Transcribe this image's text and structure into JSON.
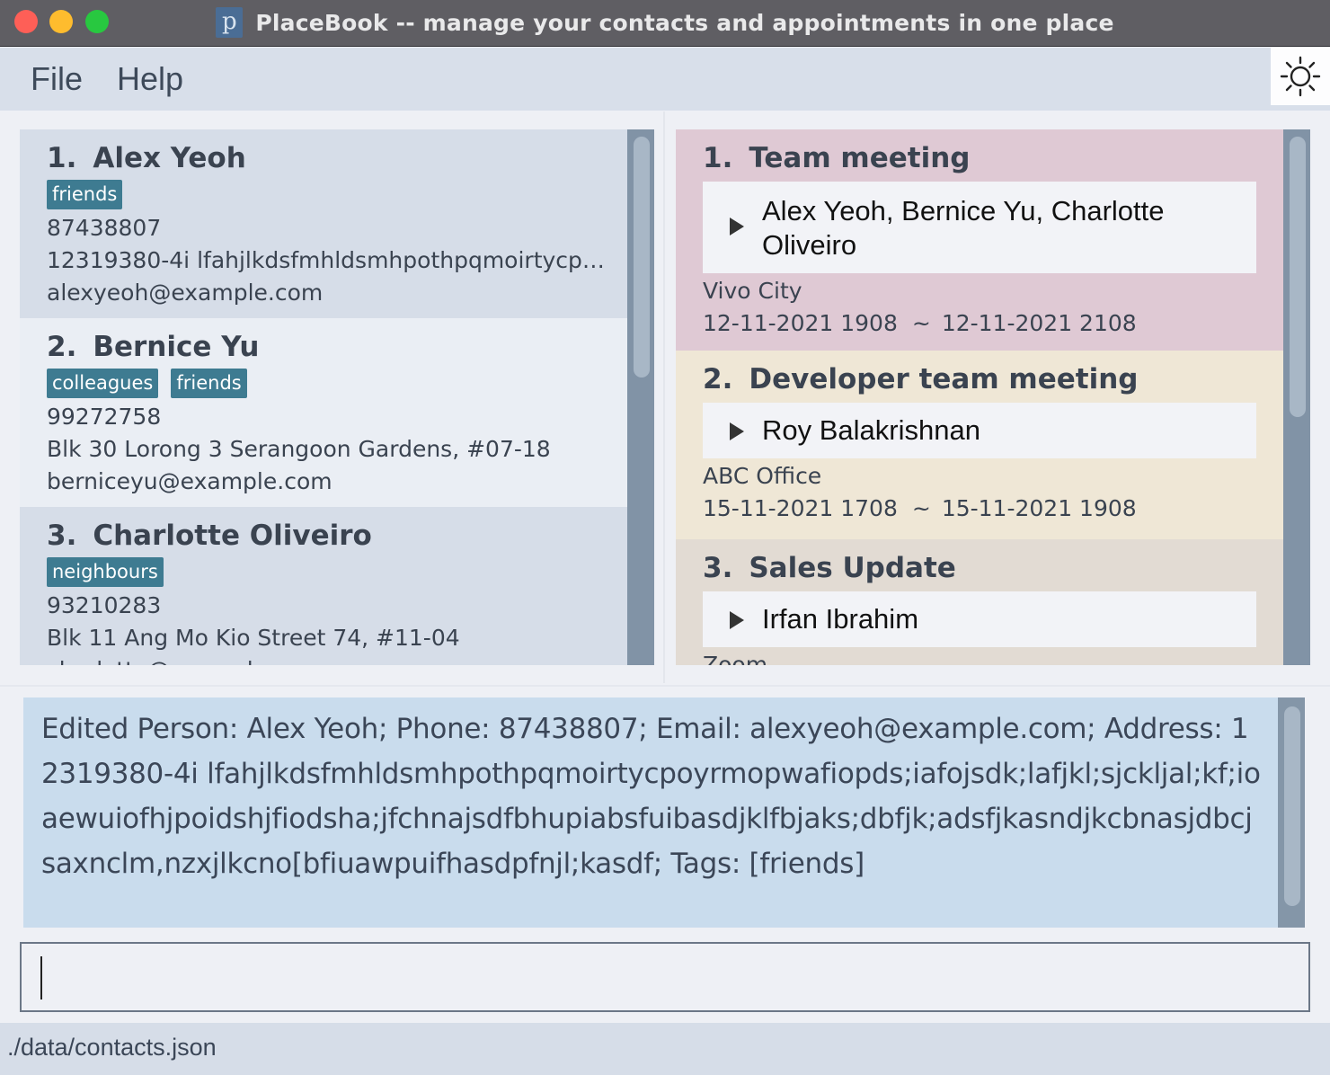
{
  "window": {
    "title": "PlaceBook -- manage your contacts and appointments in one place",
    "icon_letter": "p"
  },
  "menu": {
    "file": "File",
    "help": "Help",
    "theme_icon": "sun-icon"
  },
  "persons": [
    {
      "index": "1.",
      "name": "Alex Yeoh",
      "tags": [
        "friends"
      ],
      "phone": "87438807",
      "address": "12319380-4i lfahjlkdsfmhldsmhpothpqmoirtycpoy...",
      "email": "alexyeoh@example.com"
    },
    {
      "index": "2.",
      "name": "Bernice Yu",
      "tags": [
        "colleagues",
        "friends"
      ],
      "phone": "99272758",
      "address": "Blk 30 Lorong 3 Serangoon Gardens, #07-18",
      "email": "berniceyu@example.com"
    },
    {
      "index": "3.",
      "name": "Charlotte Oliveiro",
      "tags": [
        "neighbours"
      ],
      "phone": "93210283",
      "address": "Blk 11 Ang Mo Kio Street 74, #11-04",
      "email": "charlotte@example.com"
    }
  ],
  "appointments": [
    {
      "index": "1.",
      "title": "Team meeting",
      "clients": "Alex Yeoh, Bernice Yu, Charlotte Oliveiro",
      "location": "Vivo City",
      "start": "12-11-2021 1908",
      "end": "12-11-2021 2108"
    },
    {
      "index": "2.",
      "title": "Developer team meeting",
      "clients": "Roy Balakrishnan",
      "location": "ABC Office",
      "start": "15-11-2021 1708",
      "end": "15-11-2021 1908"
    },
    {
      "index": "3.",
      "title": "Sales Update",
      "clients": "Irfan Ibrahim",
      "location": "Zoom",
      "start": "",
      "end": ""
    }
  ],
  "range_separator": "~",
  "result": {
    "text": "Edited Person: Alex Yeoh; Phone: 87438807; Email: alexyeoh@example.com; Address: 12319380-4i lfahjlkdsfmhldsmhpothpqmoirtycpoyrmopwafiopds;iafojsdk;lafjkl;sjckljal;kf;ioaewuiofhjpoidshjfiodsha;jfchnajsdfbhupiabsfuibasdjklfbjaks;dbfjk;adsfjkasndjkcbnasjdbcjsaxnclm,nzxjlkcno[bfiuawpuifhasdpfnjl;kasdf; Tags: [friends]"
  },
  "command": {
    "value": ""
  },
  "status": {
    "path": "./data/contacts.json"
  }
}
